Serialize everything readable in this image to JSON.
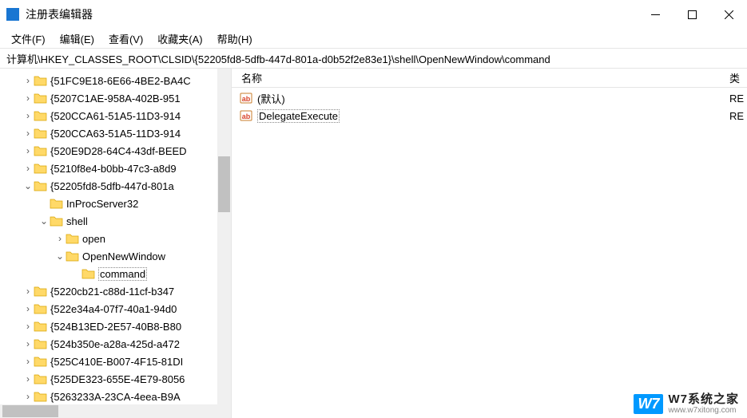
{
  "window": {
    "title": "注册表编辑器"
  },
  "menu": {
    "file": "文件(F)",
    "edit": "编辑(E)",
    "view": "查看(V)",
    "fav": "收藏夹(A)",
    "help": "帮助(H)"
  },
  "address": "计算机\\HKEY_CLASSES_ROOT\\CLSID\\{52205fd8-5dfb-447d-801a-d0b52f2e83e1}\\shell\\OpenNewWindow\\command",
  "tree": [
    {
      "indent": 28,
      "exp": ">",
      "label": "{51FC9E18-6E66-4BE2-BA4C"
    },
    {
      "indent": 28,
      "exp": ">",
      "label": "{5207C1AE-958A-402B-951"
    },
    {
      "indent": 28,
      "exp": ">",
      "label": "{520CCA61-51A5-11D3-914"
    },
    {
      "indent": 28,
      "exp": ">",
      "label": "{520CCA63-51A5-11D3-914"
    },
    {
      "indent": 28,
      "exp": ">",
      "label": "{520E9D28-64C4-43df-BEED"
    },
    {
      "indent": 28,
      "exp": ">",
      "label": "{5210f8e4-b0bb-47c3-a8d9"
    },
    {
      "indent": 28,
      "exp": "v",
      "label": "{52205fd8-5dfb-447d-801a"
    },
    {
      "indent": 48,
      "exp": "",
      "label": "InProcServer32"
    },
    {
      "indent": 48,
      "exp": "v",
      "label": "shell"
    },
    {
      "indent": 68,
      "exp": ">",
      "label": "open"
    },
    {
      "indent": 68,
      "exp": "v",
      "label": "OpenNewWindow"
    },
    {
      "indent": 88,
      "exp": "",
      "label": "command",
      "selected": true
    },
    {
      "indent": 28,
      "exp": ">",
      "label": "{5220cb21-c88d-11cf-b347"
    },
    {
      "indent": 28,
      "exp": ">",
      "label": "{522e34a4-07f7-40a1-94d0"
    },
    {
      "indent": 28,
      "exp": ">",
      "label": "{524B13ED-2E57-40B8-B80"
    },
    {
      "indent": 28,
      "exp": ">",
      "label": "{524b350e-a28a-425d-a472"
    },
    {
      "indent": 28,
      "exp": ">",
      "label": "{525C410E-B007-4F15-81DI"
    },
    {
      "indent": 28,
      "exp": ">",
      "label": "{525DE323-655E-4E79-8056"
    },
    {
      "indent": 28,
      "exp": ">",
      "label": "{5263233A-23CA-4eea-B9A"
    }
  ],
  "list": {
    "header_name": "名称",
    "header_type": "类",
    "rows": [
      {
        "name": "(默认)",
        "type": "RE",
        "selected": false
      },
      {
        "name": "DelegateExecute",
        "type": "RE",
        "selected": true
      }
    ]
  },
  "watermark": {
    "logo": "W7",
    "main": "W7系统之家",
    "sub": "www.w7xitong.com"
  }
}
